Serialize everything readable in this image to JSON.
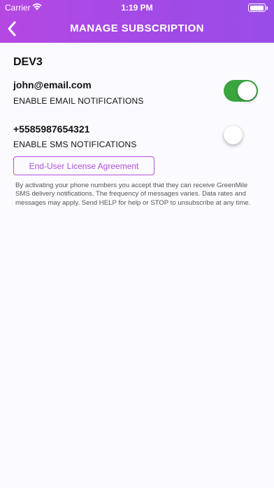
{
  "status_bar": {
    "carrier": "Carrier",
    "time": "1:19 PM",
    "battery_level": 1.0
  },
  "header": {
    "title": "MANAGE SUBSCRIPTION",
    "back_icon": "chevron-left-icon"
  },
  "colors": {
    "header_gradient_start": "#b548e3",
    "header_gradient_end": "#9a4ce8",
    "toggle_on": "#3aa43f",
    "accent": "#b84fe0",
    "background": "#fbfafe"
  },
  "subscription": {
    "device_name": "DEV3",
    "email": "john@email.com",
    "email_label": "ENABLE EMAIL NOTIFICATIONS",
    "email_enabled": true,
    "phone": "+5585987654321",
    "sms_label": "ENABLE SMS NOTIFICATIONS",
    "sms_enabled": false,
    "eula_label": "End-User License Agreement",
    "disclaimer": "By activating your phone numbers you accept that they can receive GreenMile SMS delivery notifications. The frequency of messages varies. Data rates and messages may apply. Send HELP for help or STOP to unsubscribe at any time."
  }
}
